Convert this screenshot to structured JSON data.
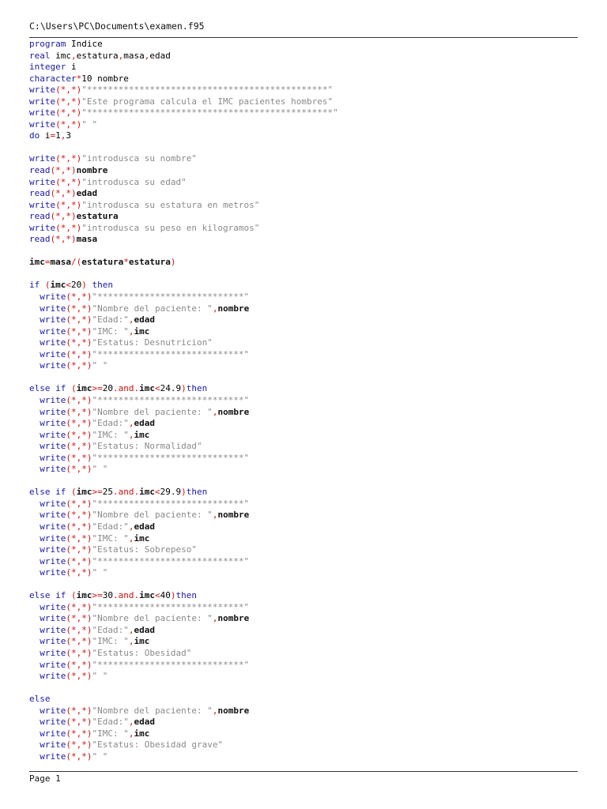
{
  "header": {
    "path": "C:\\Users\\PC\\Documents\\examen.f95"
  },
  "footer": {
    "page_label": "Page 1"
  },
  "code": {
    "lines": [
      [
        {
          "t": "kw",
          "v": "program"
        },
        {
          "t": "id",
          "v": " Indice"
        }
      ],
      [
        {
          "t": "kw",
          "v": "real"
        },
        {
          "t": "id",
          "v": " imc"
        },
        {
          "t": "op",
          "v": ","
        },
        {
          "t": "id",
          "v": "estatura"
        },
        {
          "t": "op",
          "v": ","
        },
        {
          "t": "id",
          "v": "masa"
        },
        {
          "t": "op",
          "v": ","
        },
        {
          "t": "id",
          "v": "edad"
        }
      ],
      [
        {
          "t": "kw",
          "v": "integer"
        },
        {
          "t": "id",
          "v": " i"
        }
      ],
      [
        {
          "t": "kw",
          "v": "character"
        },
        {
          "t": "op",
          "v": "*"
        },
        {
          "t": "id",
          "v": "10 nombre"
        }
      ],
      [
        {
          "t": "kw",
          "v": "write"
        },
        {
          "t": "op",
          "v": "(*,*)"
        },
        {
          "t": "str",
          "v": "\"**********************************************\""
        }
      ],
      [
        {
          "t": "kw",
          "v": "write"
        },
        {
          "t": "op",
          "v": "(*,*)"
        },
        {
          "t": "str",
          "v": "\"Este programa calcula el IMC pacientes hombres\""
        }
      ],
      [
        {
          "t": "kw",
          "v": "write"
        },
        {
          "t": "op",
          "v": "(*,*)"
        },
        {
          "t": "str",
          "v": "\"***********************************************\""
        }
      ],
      [
        {
          "t": "kw",
          "v": "write"
        },
        {
          "t": "op",
          "v": "(*,*)"
        },
        {
          "t": "str",
          "v": "\" \""
        }
      ],
      [
        {
          "t": "kw",
          "v": "do"
        },
        {
          "t": "id",
          "v": " i"
        },
        {
          "t": "op",
          "v": "="
        },
        {
          "t": "id",
          "v": "1"
        },
        {
          "t": "op",
          "v": ","
        },
        {
          "t": "id",
          "v": "3"
        }
      ],
      [],
      [
        {
          "t": "kw",
          "v": "write"
        },
        {
          "t": "op",
          "v": "(*,*)"
        },
        {
          "t": "str",
          "v": "\"introdusca su nombre\""
        }
      ],
      [
        {
          "t": "kw",
          "v": "read"
        },
        {
          "t": "op",
          "v": "(*,*)"
        },
        {
          "t": "idb",
          "v": "nombre"
        }
      ],
      [
        {
          "t": "kw",
          "v": "write"
        },
        {
          "t": "op",
          "v": "(*,*)"
        },
        {
          "t": "str",
          "v": "\"introdusca su edad\""
        }
      ],
      [
        {
          "t": "kw",
          "v": "read"
        },
        {
          "t": "op",
          "v": "(*,*)"
        },
        {
          "t": "idb",
          "v": "edad"
        }
      ],
      [
        {
          "t": "kw",
          "v": "write"
        },
        {
          "t": "op",
          "v": "(*,*)"
        },
        {
          "t": "str",
          "v": "\"introdusca su estatura en metros\""
        }
      ],
      [
        {
          "t": "kw",
          "v": "read"
        },
        {
          "t": "op",
          "v": "(*,*)"
        },
        {
          "t": "idb",
          "v": "estatura"
        }
      ],
      [
        {
          "t": "kw",
          "v": "write"
        },
        {
          "t": "op",
          "v": "(*,*)"
        },
        {
          "t": "str",
          "v": "\"introdusca su peso en kilogramos\""
        }
      ],
      [
        {
          "t": "kw",
          "v": "read"
        },
        {
          "t": "op",
          "v": "(*,*)"
        },
        {
          "t": "idb",
          "v": "masa"
        }
      ],
      [],
      [
        {
          "t": "idb",
          "v": "imc"
        },
        {
          "t": "op",
          "v": "="
        },
        {
          "t": "idb",
          "v": "masa"
        },
        {
          "t": "op",
          "v": "/("
        },
        {
          "t": "idb",
          "v": "estatura"
        },
        {
          "t": "op",
          "v": "*"
        },
        {
          "t": "idb",
          "v": "estatura"
        },
        {
          "t": "op",
          "v": ")"
        }
      ],
      [],
      [
        {
          "t": "kw",
          "v": "if"
        },
        {
          "t": "id",
          "v": " "
        },
        {
          "t": "op",
          "v": "("
        },
        {
          "t": "idb",
          "v": "imc"
        },
        {
          "t": "op",
          "v": "<"
        },
        {
          "t": "id",
          "v": "20"
        },
        {
          "t": "op",
          "v": ")"
        },
        {
          "t": "kw",
          "v": " then"
        }
      ],
      [
        {
          "t": "id",
          "v": "  "
        },
        {
          "t": "kw",
          "v": "write"
        },
        {
          "t": "op",
          "v": "(*,*)"
        },
        {
          "t": "str",
          "v": "\"****************************\""
        }
      ],
      [
        {
          "t": "id",
          "v": "  "
        },
        {
          "t": "kw",
          "v": "write"
        },
        {
          "t": "op",
          "v": "(*,*)"
        },
        {
          "t": "str",
          "v": "\"Nombre del paciente: \""
        },
        {
          "t": "op",
          "v": ","
        },
        {
          "t": "idb",
          "v": "nombre"
        }
      ],
      [
        {
          "t": "id",
          "v": "  "
        },
        {
          "t": "kw",
          "v": "write"
        },
        {
          "t": "op",
          "v": "(*,*)"
        },
        {
          "t": "str",
          "v": "\"Edad:\""
        },
        {
          "t": "op",
          "v": ","
        },
        {
          "t": "idb",
          "v": "edad"
        }
      ],
      [
        {
          "t": "id",
          "v": "  "
        },
        {
          "t": "kw",
          "v": "write"
        },
        {
          "t": "op",
          "v": "(*,*)"
        },
        {
          "t": "str",
          "v": "\"IMC: \""
        },
        {
          "t": "op",
          "v": ","
        },
        {
          "t": "idb",
          "v": "imc"
        }
      ],
      [
        {
          "t": "id",
          "v": "  "
        },
        {
          "t": "kw",
          "v": "write"
        },
        {
          "t": "op",
          "v": "(*,*)"
        },
        {
          "t": "str",
          "v": "\"Estatus: Desnutricion\""
        }
      ],
      [
        {
          "t": "id",
          "v": "  "
        },
        {
          "t": "kw",
          "v": "write"
        },
        {
          "t": "op",
          "v": "(*,*)"
        },
        {
          "t": "str",
          "v": "\"****************************\""
        }
      ],
      [
        {
          "t": "id",
          "v": "  "
        },
        {
          "t": "kw",
          "v": "write"
        },
        {
          "t": "op",
          "v": "(*,*)"
        },
        {
          "t": "str",
          "v": "\" \""
        }
      ],
      [],
      [
        {
          "t": "kw",
          "v": "else if"
        },
        {
          "t": "id",
          "v": " "
        },
        {
          "t": "op",
          "v": "("
        },
        {
          "t": "idb",
          "v": "imc"
        },
        {
          "t": "op",
          "v": ">="
        },
        {
          "t": "id",
          "v": "20"
        },
        {
          "t": "op",
          "v": ".and."
        },
        {
          "t": "idb",
          "v": "imc"
        },
        {
          "t": "op",
          "v": "<"
        },
        {
          "t": "id",
          "v": "24.9"
        },
        {
          "t": "op",
          "v": ")"
        },
        {
          "t": "kw",
          "v": "then"
        }
      ],
      [
        {
          "t": "id",
          "v": "  "
        },
        {
          "t": "kw",
          "v": "write"
        },
        {
          "t": "op",
          "v": "(*,*)"
        },
        {
          "t": "str",
          "v": "\"****************************\""
        }
      ],
      [
        {
          "t": "id",
          "v": "  "
        },
        {
          "t": "kw",
          "v": "write"
        },
        {
          "t": "op",
          "v": "(*,*)"
        },
        {
          "t": "str",
          "v": "\"Nombre del paciente: \""
        },
        {
          "t": "op",
          "v": ","
        },
        {
          "t": "idb",
          "v": "nombre"
        }
      ],
      [
        {
          "t": "id",
          "v": "  "
        },
        {
          "t": "kw",
          "v": "write"
        },
        {
          "t": "op",
          "v": "(*,*)"
        },
        {
          "t": "str",
          "v": "\"Edad:\""
        },
        {
          "t": "op",
          "v": ","
        },
        {
          "t": "idb",
          "v": "edad"
        }
      ],
      [
        {
          "t": "id",
          "v": "  "
        },
        {
          "t": "kw",
          "v": "write"
        },
        {
          "t": "op",
          "v": "(*,*)"
        },
        {
          "t": "str",
          "v": "\"IMC: \""
        },
        {
          "t": "op",
          "v": ","
        },
        {
          "t": "idb",
          "v": "imc"
        }
      ],
      [
        {
          "t": "id",
          "v": "  "
        },
        {
          "t": "kw",
          "v": "write"
        },
        {
          "t": "op",
          "v": "(*,*)"
        },
        {
          "t": "str",
          "v": "\"Estatus: Normalidad\""
        }
      ],
      [
        {
          "t": "id",
          "v": "  "
        },
        {
          "t": "kw",
          "v": "write"
        },
        {
          "t": "op",
          "v": "(*,*)"
        },
        {
          "t": "str",
          "v": "\"****************************\""
        }
      ],
      [
        {
          "t": "id",
          "v": "  "
        },
        {
          "t": "kw",
          "v": "write"
        },
        {
          "t": "op",
          "v": "(*,*)"
        },
        {
          "t": "str",
          "v": "\" \""
        }
      ],
      [],
      [
        {
          "t": "kw",
          "v": "else if"
        },
        {
          "t": "id",
          "v": " "
        },
        {
          "t": "op",
          "v": "("
        },
        {
          "t": "idb",
          "v": "imc"
        },
        {
          "t": "op",
          "v": ">="
        },
        {
          "t": "id",
          "v": "25"
        },
        {
          "t": "op",
          "v": ".and."
        },
        {
          "t": "idb",
          "v": "imc"
        },
        {
          "t": "op",
          "v": "<"
        },
        {
          "t": "id",
          "v": "29.9"
        },
        {
          "t": "op",
          "v": ")"
        },
        {
          "t": "kw",
          "v": "then"
        }
      ],
      [
        {
          "t": "id",
          "v": "  "
        },
        {
          "t": "kw",
          "v": "write"
        },
        {
          "t": "op",
          "v": "(*,*)"
        },
        {
          "t": "str",
          "v": "\"****************************\""
        }
      ],
      [
        {
          "t": "id",
          "v": "  "
        },
        {
          "t": "kw",
          "v": "write"
        },
        {
          "t": "op",
          "v": "(*,*)"
        },
        {
          "t": "str",
          "v": "\"Nombre del paciente: \""
        },
        {
          "t": "op",
          "v": ","
        },
        {
          "t": "idb",
          "v": "nombre"
        }
      ],
      [
        {
          "t": "id",
          "v": "  "
        },
        {
          "t": "kw",
          "v": "write"
        },
        {
          "t": "op",
          "v": "(*,*)"
        },
        {
          "t": "str",
          "v": "\"Edad:\""
        },
        {
          "t": "op",
          "v": ","
        },
        {
          "t": "idb",
          "v": "edad"
        }
      ],
      [
        {
          "t": "id",
          "v": "  "
        },
        {
          "t": "kw",
          "v": "write"
        },
        {
          "t": "op",
          "v": "(*,*)"
        },
        {
          "t": "str",
          "v": "\"IMC: \""
        },
        {
          "t": "op",
          "v": ","
        },
        {
          "t": "idb",
          "v": "imc"
        }
      ],
      [
        {
          "t": "id",
          "v": "  "
        },
        {
          "t": "kw",
          "v": "write"
        },
        {
          "t": "op",
          "v": "(*,*)"
        },
        {
          "t": "str",
          "v": "\"Estatus: Sobrepeso\""
        }
      ],
      [
        {
          "t": "id",
          "v": "  "
        },
        {
          "t": "kw",
          "v": "write"
        },
        {
          "t": "op",
          "v": "(*,*)"
        },
        {
          "t": "str",
          "v": "\"****************************\""
        }
      ],
      [
        {
          "t": "id",
          "v": "  "
        },
        {
          "t": "kw",
          "v": "write"
        },
        {
          "t": "op",
          "v": "(*,*)"
        },
        {
          "t": "str",
          "v": "\" \""
        }
      ],
      [],
      [
        {
          "t": "kw",
          "v": "else if"
        },
        {
          "t": "id",
          "v": " "
        },
        {
          "t": "op",
          "v": "("
        },
        {
          "t": "idb",
          "v": "imc"
        },
        {
          "t": "op",
          "v": ">="
        },
        {
          "t": "id",
          "v": "30"
        },
        {
          "t": "op",
          "v": ".and."
        },
        {
          "t": "idb",
          "v": "imc"
        },
        {
          "t": "op",
          "v": "<"
        },
        {
          "t": "id",
          "v": "40"
        },
        {
          "t": "op",
          "v": ")"
        },
        {
          "t": "kw",
          "v": "then"
        }
      ],
      [
        {
          "t": "id",
          "v": "  "
        },
        {
          "t": "kw",
          "v": "write"
        },
        {
          "t": "op",
          "v": "(*,*)"
        },
        {
          "t": "str",
          "v": "\"****************************\""
        }
      ],
      [
        {
          "t": "id",
          "v": "  "
        },
        {
          "t": "kw",
          "v": "write"
        },
        {
          "t": "op",
          "v": "(*,*)"
        },
        {
          "t": "str",
          "v": "\"Nombre del paciente: \""
        },
        {
          "t": "op",
          "v": ","
        },
        {
          "t": "idb",
          "v": "nombre"
        }
      ],
      [
        {
          "t": "id",
          "v": "  "
        },
        {
          "t": "kw",
          "v": "write"
        },
        {
          "t": "op",
          "v": "(*,*)"
        },
        {
          "t": "str",
          "v": "\"Edad:\""
        },
        {
          "t": "op",
          "v": ","
        },
        {
          "t": "idb",
          "v": "edad"
        }
      ],
      [
        {
          "t": "id",
          "v": "  "
        },
        {
          "t": "kw",
          "v": "write"
        },
        {
          "t": "op",
          "v": "(*,*)"
        },
        {
          "t": "str",
          "v": "\"IMC: \""
        },
        {
          "t": "op",
          "v": ","
        },
        {
          "t": "idb",
          "v": "imc"
        }
      ],
      [
        {
          "t": "id",
          "v": "  "
        },
        {
          "t": "kw",
          "v": "write"
        },
        {
          "t": "op",
          "v": "(*,*)"
        },
        {
          "t": "str",
          "v": "\"Estatus: Obesidad\""
        }
      ],
      [
        {
          "t": "id",
          "v": "  "
        },
        {
          "t": "kw",
          "v": "write"
        },
        {
          "t": "op",
          "v": "(*,*)"
        },
        {
          "t": "str",
          "v": "\"****************************\""
        }
      ],
      [
        {
          "t": "id",
          "v": "  "
        },
        {
          "t": "kw",
          "v": "write"
        },
        {
          "t": "op",
          "v": "(*,*)"
        },
        {
          "t": "str",
          "v": "\" \""
        }
      ],
      [],
      [
        {
          "t": "kw",
          "v": "else"
        }
      ],
      [
        {
          "t": "id",
          "v": "  "
        },
        {
          "t": "kw",
          "v": "write"
        },
        {
          "t": "op",
          "v": "(*,*)"
        },
        {
          "t": "str",
          "v": "\"Nombre del paciente: \""
        },
        {
          "t": "op",
          "v": ","
        },
        {
          "t": "idb",
          "v": "nombre"
        }
      ],
      [
        {
          "t": "id",
          "v": "  "
        },
        {
          "t": "kw",
          "v": "write"
        },
        {
          "t": "op",
          "v": "(*,*)"
        },
        {
          "t": "str",
          "v": "\"Edad:\""
        },
        {
          "t": "op",
          "v": ","
        },
        {
          "t": "idb",
          "v": "edad"
        }
      ],
      [
        {
          "t": "id",
          "v": "  "
        },
        {
          "t": "kw",
          "v": "write"
        },
        {
          "t": "op",
          "v": "(*,*)"
        },
        {
          "t": "str",
          "v": "\"IMC: \""
        },
        {
          "t": "op",
          "v": ","
        },
        {
          "t": "idb",
          "v": "imc"
        }
      ],
      [
        {
          "t": "id",
          "v": "  "
        },
        {
          "t": "kw",
          "v": "write"
        },
        {
          "t": "op",
          "v": "(*,*)"
        },
        {
          "t": "str",
          "v": "\"Estatus: Obesidad grave\""
        }
      ],
      [
        {
          "t": "id",
          "v": "  "
        },
        {
          "t": "kw",
          "v": "write"
        },
        {
          "t": "op",
          "v": "(*,*)"
        },
        {
          "t": "str",
          "v": "\" \""
        }
      ]
    ]
  }
}
